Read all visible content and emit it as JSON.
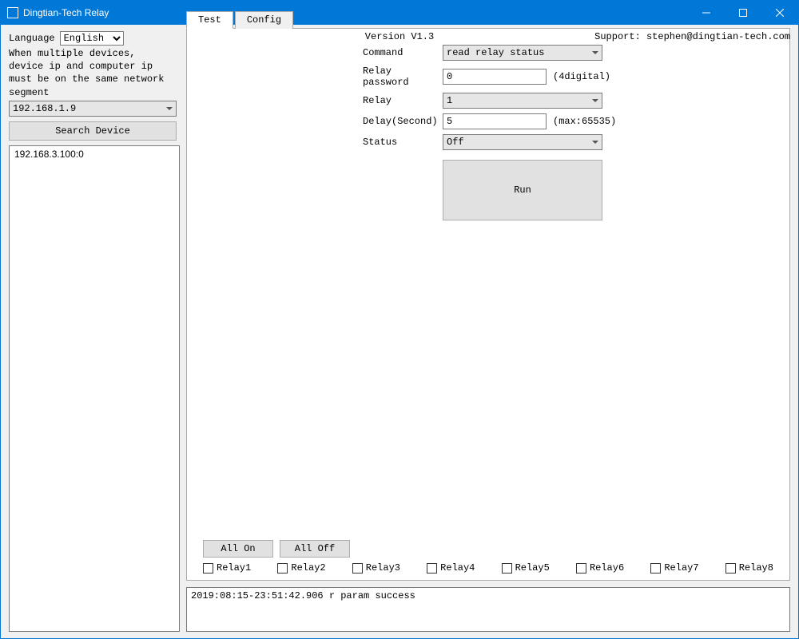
{
  "window": {
    "title": "Dingtian-Tech Relay"
  },
  "header": {
    "language_label": "Language",
    "language_value": "English",
    "version": "Version V1.3",
    "support": "Support: stephen@dingtian-tech.com",
    "note_line1": "When multiple devices,",
    "note_line2": "device ip and computer ip",
    "note_line3": "must be on the same network segment"
  },
  "left": {
    "local_ip": "192.168.1.9",
    "search_button": "Search Device",
    "device_list": [
      "192.168.3.100:0"
    ]
  },
  "tabs": {
    "test": "Test",
    "config": "Config"
  },
  "form": {
    "command_label": "Command",
    "command_value": "read relay status",
    "password_label": "Relay password",
    "password_value": "0",
    "password_hint": "(4digital)",
    "relay_label": "Relay",
    "relay_value": "1",
    "delay_label": "Delay(Second)",
    "delay_value": "5",
    "delay_hint": "(max:65535)",
    "status_label": "Status",
    "status_value": "Off",
    "run_button": "Run"
  },
  "bottom": {
    "all_on": "All On",
    "all_off": "All Off",
    "relays": [
      "Relay1",
      "Relay2",
      "Relay3",
      "Relay4",
      "Relay5",
      "Relay6",
      "Relay7",
      "Relay8"
    ]
  },
  "log": {
    "line1": "2019:08:15-23:51:42.906 r param success"
  }
}
